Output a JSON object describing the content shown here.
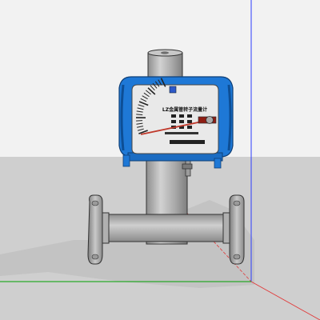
{
  "viewport": {
    "sky_color": "#f2f2f2",
    "ground_color": "#cfcfcf",
    "shadow_color": "#c2c2c2",
    "green_axis_color": "#00a000",
    "blue_axis_color": "#2c3cff",
    "red_axis_color": "#e13a3a"
  },
  "flowmeter": {
    "dial_label": "LZ金属管转子流量计",
    "housing_color": "#1e78d6",
    "pipe_color": "#b5b5b5",
    "dial_face_color": "#e9e9e9",
    "pointer_color": "#c0392b"
  }
}
